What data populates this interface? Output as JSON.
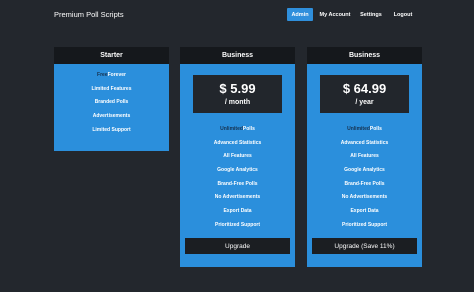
{
  "header": {
    "brand": "Premium Poll Scripts",
    "nav": [
      {
        "label": "Admin",
        "active": true
      },
      {
        "label": "My Account",
        "active": false
      },
      {
        "label": "Settings",
        "active": false
      },
      {
        "label": "Logout",
        "active": false
      }
    ]
  },
  "plans": [
    {
      "title": "Starter",
      "features": [
        {
          "highlight": "Free",
          "rest": " Forever"
        },
        {
          "highlight": "",
          "rest": "Limited Features"
        },
        {
          "highlight": "",
          "rest": "Branded Polls"
        },
        {
          "highlight": "",
          "rest": "Advertisements"
        },
        {
          "highlight": "",
          "rest": "Limited Support"
        }
      ]
    },
    {
      "title": "Business",
      "price": "$ 5.99",
      "period": "/ month",
      "features": [
        {
          "highlight": "Unlimited",
          "rest": " Polls"
        },
        {
          "highlight": "",
          "rest": "Advanced Statistics"
        },
        {
          "highlight": "",
          "rest": "All Features"
        },
        {
          "highlight": "",
          "rest": "Google Analytics"
        },
        {
          "highlight": "",
          "rest": "Brand-Free Polls"
        },
        {
          "highlight": "",
          "rest": "No Advertisements"
        },
        {
          "highlight": "",
          "rest": "Export Data"
        },
        {
          "highlight": "",
          "rest": "Prioritized Support"
        }
      ],
      "button": "Upgrade"
    },
    {
      "title": "Business",
      "price": "$ 64.99",
      "period": "/ year",
      "features": [
        {
          "highlight": "Unlimited",
          "rest": " Polls"
        },
        {
          "highlight": "",
          "rest": "Advanced Statistics"
        },
        {
          "highlight": "",
          "rest": "All Features"
        },
        {
          "highlight": "",
          "rest": "Google Analytics"
        },
        {
          "highlight": "",
          "rest": "Brand-Free Polls"
        },
        {
          "highlight": "",
          "rest": "No Advertisements"
        },
        {
          "highlight": "",
          "rest": "Export Data"
        },
        {
          "highlight": "",
          "rest": "Prioritized Support"
        }
      ],
      "button": "Upgrade (Save 11%)"
    }
  ],
  "colors": {
    "background": "#23272d",
    "accent": "#2b8fdc",
    "header_band": "#15181c",
    "highlight_text": "#16314f"
  }
}
